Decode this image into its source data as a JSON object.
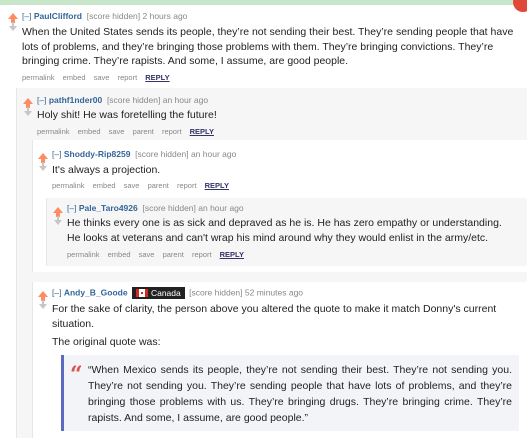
{
  "comments": [
    {
      "expand": "[–]",
      "author": "PaulClifford",
      "score": "[score hidden]",
      "time": "2 hours ago",
      "body": "When the United States sends its people, they’re not sending their best. They’re sending people that have lots of problems, and they’re bringing those problems with them. They’re bringing convictions. They’re bringing crime. They’re rapists. And some, I assume, are good people.",
      "buttons": [
        "permalink",
        "embed",
        "save",
        "report"
      ],
      "reply": "REPLY"
    },
    {
      "expand": "[–]",
      "author": "pathf1nder00",
      "score": "[score hidden]",
      "time": "an hour ago",
      "body": "Holy shit! He was foretelling the future!",
      "buttons": [
        "permalink",
        "embed",
        "save",
        "parent",
        "report"
      ],
      "reply": "REPLY"
    },
    {
      "expand": "[–]",
      "author": "Shoddy-Rip8259",
      "score": "[score hidden]",
      "time": "an hour ago",
      "body": "It's always a projection.",
      "buttons": [
        "permalink",
        "embed",
        "save",
        "parent",
        "report"
      ],
      "reply": "REPLY"
    },
    {
      "expand": "[–]",
      "author": "Pale_Taro4926",
      "score": "[score hidden]",
      "time": "an hour ago",
      "body": "He thinks every one is as sick and depraved as he is. He has zero empathy or understanding. He looks at veterans and can't wrap his mind around why they would enlist in the army/etc.",
      "buttons": [
        "permalink",
        "embed",
        "save",
        "parent",
        "report"
      ],
      "reply": "REPLY"
    },
    {
      "expand": "[–]",
      "author": "Andy_B_Goode",
      "flair": "Canada",
      "score": "[score hidden]",
      "time": "52 minutes ago",
      "body": "For the sake of clarity, the person above you altered the quote to make it match Donny's current situation.",
      "body2": "The original quote was:",
      "quote_mark": "“",
      "quote": "“When Mexico sends its people, they’re not sending their best. They’re not sending you. They’re not sending you. They’re sending people that have lots of problems, and they’re bringing those problems with us. They’re bringing drugs. They’re bringing crime. They’re rapists. And some, I assume, are good people.”"
    }
  ],
  "colors": {
    "upvote": "#ff8b60",
    "author": "#336699",
    "quote_border": "#5c6bc0",
    "quote_mark": "#d9534f"
  },
  "icons": [
    "upvote-arrow-icon",
    "downvote-arrow-icon",
    "canada-flag-icon",
    "quote-icon",
    "close-icon"
  ]
}
